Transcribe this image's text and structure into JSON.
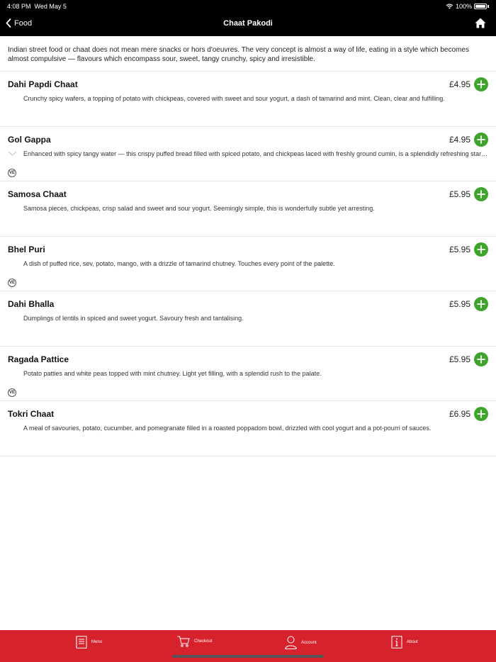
{
  "status": {
    "time": "4:08 PM",
    "date": "Wed May 5",
    "battery": "100%"
  },
  "nav": {
    "back_label": "Food",
    "title": "Chaat Pakodi"
  },
  "intro": "Indian street food or chaat does not mean mere snacks or hors d'oeuvres. The very concept is almost a way of life, eating in a style which becomes almost compulsive — flavours which encompass sour, sweet, tangy crunchy, spicy and irresistible.",
  "ve_badge": "VE",
  "items": [
    {
      "name": "Dahi Papdi Chaat",
      "price": "£4.95",
      "description": "Crunchy spicy wafers, a topping of potato with chickpeas, covered with sweet and sour yogurt, a dash of tamarind and mint. Clean, clear and fulfilling."
    },
    {
      "name": "Gol Gappa",
      "price": "£4.95",
      "description": "Enhanced with spicy tangy water — this crispy puffed bread filled with spiced potato, and chickpeas laced with freshly ground cumin, is a splendidly refreshing starter."
    },
    {
      "name": "Samosa Chaat",
      "price": "£5.95",
      "description": "Samosa pieces, chickpeas, crisp salad and sweet and sour yogurt. Seemingly simple, this is wonderfully subtle yet arresting."
    },
    {
      "name": "Bhel Puri",
      "price": "£5.95",
      "description": "A dish of puffed rice, sev, potato, mango, with a drizzle of tamarind chutney. Touches every point of the palette."
    },
    {
      "name": "Dahi Bhalla",
      "price": "£5.95",
      "description": "Dumplings of lentils in spiced and sweet yogurt. Savoury fresh and tantalising."
    },
    {
      "name": "Ragada Pattice",
      "price": "£5.95",
      "description": "Potato patties and white peas topped with mint chutney. Light yet filling, with a splendid rush to the palate."
    },
    {
      "name": "Tokri Chaat",
      "price": "£6.95",
      "description": "A meal of savouries, potato, cucumber, and pomegranate filled in a roasted poppadom bowl, drizzled with cool yogurt and a pot-pourri of sauces."
    }
  ],
  "tabs": {
    "menu": "Menu",
    "checkout": "Checkout",
    "account": "Account",
    "about": "About"
  },
  "colors": {
    "accent_green": "#3ea52c",
    "tabbar_red": "#d5222d",
    "bar_black": "#000000"
  }
}
